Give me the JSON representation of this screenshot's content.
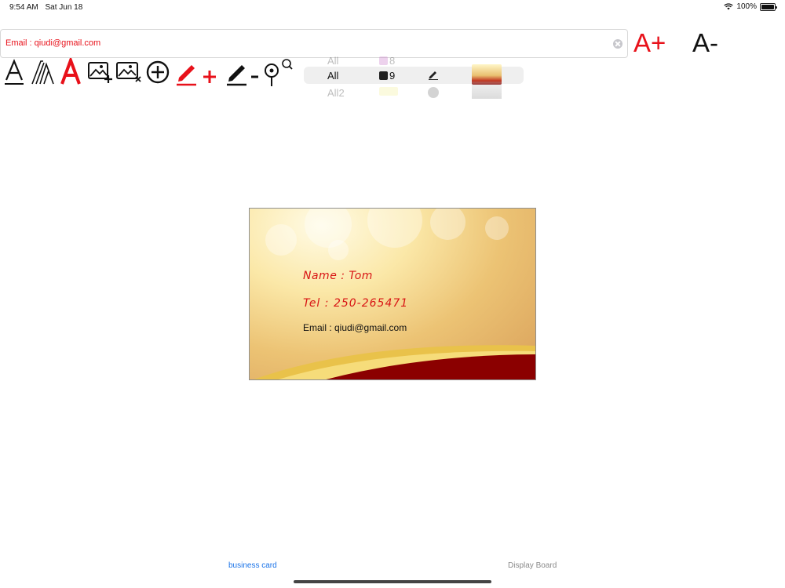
{
  "status_bar": {
    "time": "9:54 AM",
    "date": "Sat Jun 18",
    "battery": "100%",
    "battery_level": 1.0
  },
  "editor": {
    "text_field_value": "Email : qiudi@gmail.com",
    "font_increase_label": "A+",
    "font_decrease_label": "A-",
    "accent_color": "#e8111a"
  },
  "toolbar": {
    "tools": [
      "text-underline-icon",
      "text-italic-icon",
      "text-color-icon",
      "add-image-icon",
      "remove-image-icon",
      "add-circle-icon",
      "pen-add-icon",
      "pen-remove-icon",
      "zoom-touch-icon"
    ]
  },
  "picker": {
    "rows": [
      {
        "label": "All",
        "number": "8",
        "faded": true
      },
      {
        "label": "All",
        "number": "9",
        "faded": false
      },
      {
        "label": "All2",
        "number": "",
        "faded": true
      }
    ]
  },
  "card": {
    "name": "Name : Tom",
    "tel": "Tel : 250-265471",
    "email": "Email : qiudi@gmail.com",
    "name_color": "#d81414",
    "wave_color": "#8b0000"
  },
  "tabs": [
    {
      "label": "business card",
      "active": true
    },
    {
      "label": "Display Board",
      "active": false
    }
  ]
}
